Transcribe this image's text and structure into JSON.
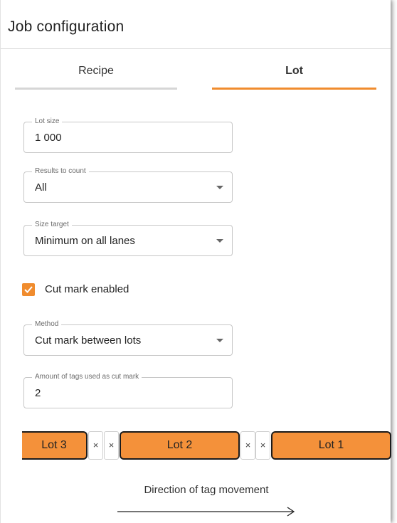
{
  "window": {
    "title": "Job configuration"
  },
  "tabs": [
    {
      "label": "Recipe",
      "active": false
    },
    {
      "label": "Lot",
      "active": true
    }
  ],
  "form": {
    "lot_size": {
      "label": "Lot size",
      "value": "1 000"
    },
    "results_to_count": {
      "label": "Results to count",
      "value": "All"
    },
    "size_target": {
      "label": "Size target",
      "value": "Minimum on all lanes"
    },
    "cut_mark": {
      "label": "Cut mark enabled",
      "checked": true
    },
    "method": {
      "label": "Method",
      "value": "Cut mark between lots"
    },
    "amount_tags": {
      "label": "Amount of tags used as cut mark",
      "value": "2"
    }
  },
  "diagram": {
    "lots": [
      "Lot 3",
      "Lot 2",
      "Lot 1"
    ],
    "separator": "×",
    "direction_label": "Direction of tag movement"
  },
  "colors": {
    "accent": "#f08c2e",
    "lot_fill": "#f4913a"
  }
}
